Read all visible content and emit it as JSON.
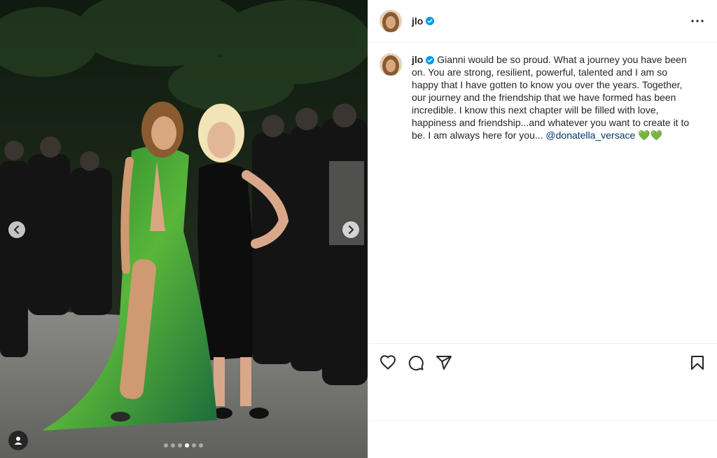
{
  "post": {
    "username": "jlo",
    "verified": true,
    "caption_user": "jlo",
    "caption_text": "Gianni would be so proud. What a journey you have been on. You are strong, resilient, powerful, talented and I am so happy that I have gotten to know you over the years. Together, our journey and the friendship that we have formed has been incredible. I know this next chapter will be filled with love, happiness and friendship...and whatever you want to create it to be. I am always here for you... ",
    "mention": "@donatella_versace",
    "emoji": "💚💚"
  },
  "carousel": {
    "total_slides": 6,
    "active_index": 3
  },
  "icons": {
    "more": "more-options-icon",
    "like": "heart-icon",
    "comment": "comment-icon",
    "share": "share-icon",
    "save": "bookmark-icon",
    "prev": "chevron-left-icon",
    "next": "chevron-right-icon",
    "tags": "user-tag-icon"
  },
  "colors": {
    "verified": "#0095f6",
    "mention": "#00376b",
    "dress_green": "#2f8f2a",
    "background": "#ffffff"
  }
}
